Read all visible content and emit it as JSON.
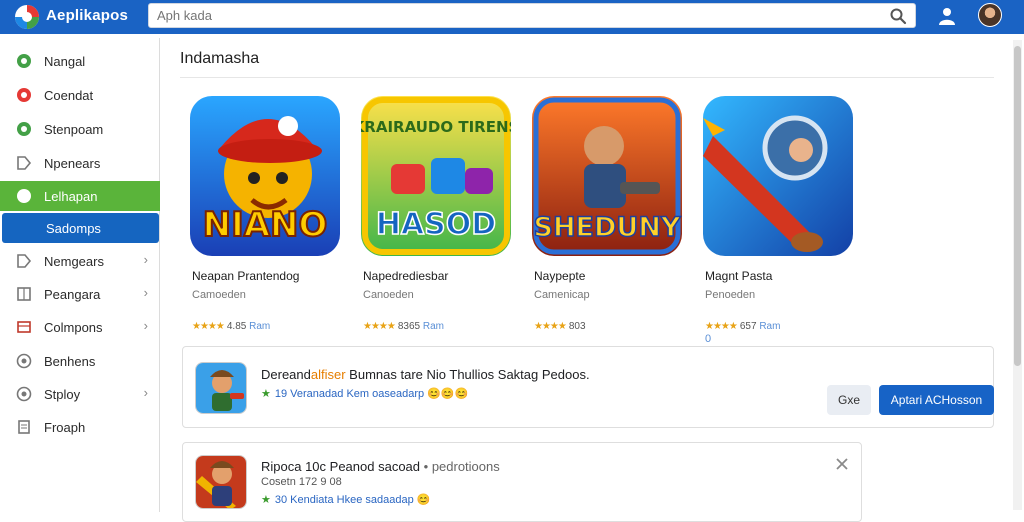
{
  "app": {
    "title": "Aeplikapos"
  },
  "search": {
    "placeholder": "Aph kada"
  },
  "sidebar": {
    "items": [
      {
        "label": "Nangal",
        "icon": "circle-green-icon"
      },
      {
        "label": "Coendat",
        "icon": "circle-red-icon"
      },
      {
        "label": "Stenpoam",
        "icon": "circle-green-icon"
      },
      {
        "label": "Npenears",
        "icon": "tag-icon"
      },
      {
        "label": "Lelhapan",
        "icon": "circle-white-icon"
      },
      {
        "label": "Sadomps",
        "icon": ""
      },
      {
        "label": "Nemgears",
        "icon": "tag-icon"
      },
      {
        "label": "Peangara",
        "icon": "grid-icon"
      },
      {
        "label": "Colmpons",
        "icon": "box-icon"
      },
      {
        "label": "Benhens",
        "icon": "circle-gray-icon"
      },
      {
        "label": "Stploy",
        "icon": "circle-gray-icon"
      },
      {
        "label": "Froaph",
        "icon": "doc-icon"
      }
    ]
  },
  "main": {
    "section_title": "Indamasha",
    "apps": [
      {
        "name": "Neapan Prantendog",
        "category": "Camoeden",
        "rating": "4.85 Ram",
        "rating_value": "4.85",
        "rating_extra": "Ram",
        "art_title": "NIANO"
      },
      {
        "name": "Napedrediesbar",
        "category": "Canoeden",
        "rating": "8365 Ram",
        "rating_value": "8365",
        "rating_extra": "Ram",
        "art_title": "HASOD",
        "art_top": "KRAIRAUDO TIRENS"
      },
      {
        "name": "Naypepte",
        "category": "Camenicap",
        "rating": "803",
        "rating_value": "803",
        "rating_extra": "",
        "art_title": "SHEDUNY"
      },
      {
        "name": "Magnt Pasta",
        "category": "Penoeden",
        "rating": "657 Ram",
        "rating_value": "657",
        "rating_extra": "Ram",
        "under": "0"
      }
    ]
  },
  "notification": {
    "title_prefix": "Dereand",
    "title_highlight": "alfiser",
    "title_rest": " Bumnas tare Nio Thullios Saktag Pedoos.",
    "rating": "19 Veranadad Kem oaseadarp",
    "emoji": "😊😊😊",
    "secondary_button": "Gxe",
    "primary_button": "Aptari ACHosson"
  },
  "notification2": {
    "title": "Ripoca 10c Peanod sacoad",
    "title_sub": "pedrotioons",
    "subtitle": "Cosetn 172 9 08",
    "rating": "30 Kendiata Hkee sadaadap",
    "emoji": "😊"
  },
  "colors": {
    "header": "#1a63c4",
    "accent_green": "#5ab43a",
    "accent_blue": "#1565c0",
    "star": "#e8a317"
  }
}
